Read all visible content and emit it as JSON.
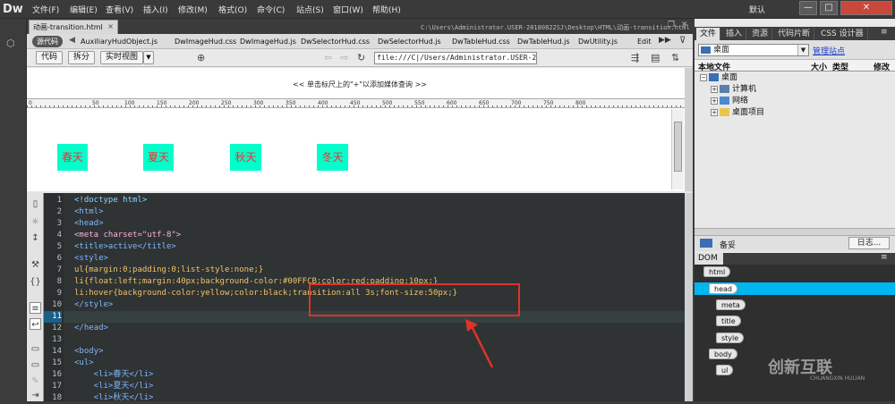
{
  "app": {
    "logo": "Dw"
  },
  "menu": [
    "文件(F)",
    "编辑(E)",
    "查看(V)",
    "插入(I)",
    "修改(M)",
    "格式(O)",
    "命令(C)",
    "站点(S)",
    "窗口(W)",
    "帮助(H)"
  ],
  "workspace": {
    "label": "默认"
  },
  "window_controls": [
    "—",
    "□",
    "✕"
  ],
  "document": {
    "tab_label": "动画-transition.html",
    "tab_close": "×",
    "path": "C:\\Users\\Administrator.USER-20180822SJ\\Desktop\\HTML\\动画-transition.html"
  },
  "related_files": {
    "source_label": "源代码",
    "files": [
      "AuxiliaryHudObject.js",
      "DwImageHud.css",
      "DwImageHud.js",
      "DwSelectorHud.css",
      "DwSelectorHud.js",
      "DwTableHud.css",
      "DwTableHud.js",
      "DwUtility.js",
      "Edit"
    ]
  },
  "toolbar": {
    "code_label": "代码",
    "split_label": "拆分",
    "live_label": "实时视图",
    "url_value": "file:///C|/Users/Administrator.USER-20"
  },
  "design_view": {
    "hint": "<< 单击标尺上的\"+\"以添加媒体查询 >>",
    "ruler_labels": [
      "0",
      "50",
      "100",
      "150",
      "200",
      "250",
      "300",
      "350",
      "400",
      "450",
      "500",
      "550",
      "600",
      "650",
      "700",
      "750",
      "800"
    ],
    "items": [
      "春天",
      "夏天",
      "秋天",
      "冬天"
    ],
    "item_bg": "#00FFCB",
    "item_color": "#ff2a2a"
  },
  "code": {
    "line_numbers": [
      "1",
      "2",
      "3",
      "4",
      "5",
      "6",
      "7",
      "8",
      "9",
      "10",
      "11",
      "12",
      "13",
      "14",
      "15",
      "16",
      "17",
      "18"
    ],
    "current_line": "11",
    "lines": [
      "<!doctype html>",
      "<html>",
      "<head>",
      "<meta charset=\"utf-8\">",
      "<title>active</title>",
      "<style>",
      "ul{margin:0;padding:0;list-style:none;}",
      "li{float:left;margin:40px;background-color:#00FFCB;color:red;padding:10px;}",
      "li:hover{background-color:yellow;color:black;transition:all 3s;font-size:50px;}",
      "</style>",
      "",
      "</head>",
      "",
      "<body>",
      "<ul>",
      "    <li>春天</li>",
      "    <li>夏天</li>",
      "    <li>秋天</li>"
    ],
    "highlight_color": "#e0322a"
  },
  "right_panel": {
    "tabs": [
      "文件",
      "插入",
      "资源",
      "代码片断",
      "CSS 设计器"
    ],
    "site_select": "桌面",
    "manage_sites": "管理站点",
    "file_headers": [
      "本地文件",
      "大小",
      "类型",
      "修改"
    ],
    "tree": [
      {
        "label": "桌面",
        "level": 0
      },
      {
        "label": "计算机",
        "level": 1
      },
      {
        "label": "网络",
        "level": 1
      },
      {
        "label": "桌面项目",
        "level": 1
      }
    ],
    "status": "备妥",
    "log_button": "日志...",
    "dom_tab": "DOM",
    "dom_nodes": [
      {
        "label": "html",
        "level": 0
      },
      {
        "label": "head",
        "level": 1
      },
      {
        "label": "meta",
        "level": 2
      },
      {
        "label": "title",
        "level": 2
      },
      {
        "label": "style",
        "level": 2
      },
      {
        "label": "body",
        "level": 1
      },
      {
        "label": "ul",
        "level": 2
      }
    ],
    "dom_selected": "head",
    "selection_color": "#00b6f0"
  },
  "watermark": {
    "text": "创新互联",
    "sub": "CHUANGXIN HULIAN"
  }
}
